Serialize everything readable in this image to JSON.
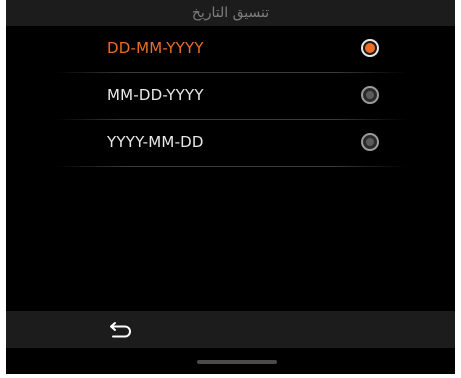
{
  "header": {
    "title": "تنسيق التاريخ"
  },
  "date_format_options": [
    {
      "label": "DD-MM-YYYY",
      "selected": true
    },
    {
      "label": "MM-DD-YYYY",
      "selected": false
    },
    {
      "label": "YYYY-MM-DD",
      "selected": false
    }
  ],
  "colors": {
    "accent": "#ee6f24",
    "background": "#000000",
    "bar": "#1c1c1c",
    "text": "#e8e8e8"
  },
  "footer": {
    "back_icon": "back-arrow-icon"
  }
}
